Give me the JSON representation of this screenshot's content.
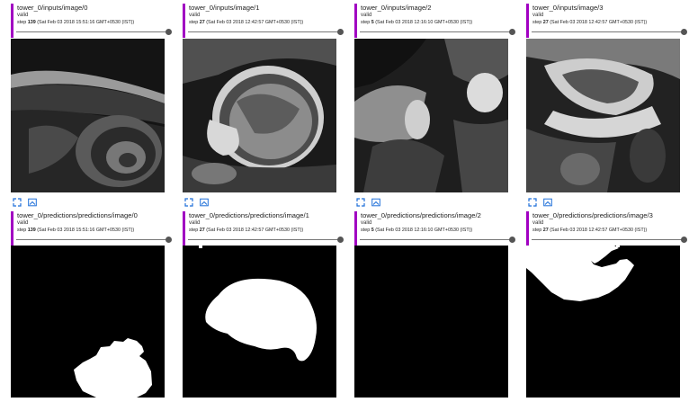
{
  "cards": [
    {
      "tag": "tower_0/inputs/image/0",
      "run": "valid",
      "step_label": "step",
      "step": "139",
      "time": "(Sat Feb 03 2018 15:51:16 GMT+0530 (IST))",
      "kind": "mri"
    },
    {
      "tag": "tower_0/inputs/image/1",
      "run": "valid",
      "step_label": "step",
      "step": "27",
      "time": "(Sat Feb 03 2018 12:42:57 GMT+0530 (IST))",
      "kind": "mri"
    },
    {
      "tag": "tower_0/inputs/image/2",
      "run": "valid",
      "step_label": "step",
      "step": "5",
      "time": "(Sat Feb 03 2018 12:16:10 GMT+0530 (IST))",
      "kind": "mri"
    },
    {
      "tag": "tower_0/inputs/image/3",
      "run": "valid",
      "step_label": "step",
      "step": "27",
      "time": "(Sat Feb 03 2018 12:42:57 GMT+0530 (IST))",
      "kind": "mri"
    },
    {
      "tag": "tower_0/predictions/predictions/image/0",
      "run": "valid",
      "step_label": "step",
      "step": "139",
      "time": "(Sat Feb 03 2018 15:51:16 GMT+0530 (IST))",
      "kind": "mask"
    },
    {
      "tag": "tower_0/predictions/predictions/image/1",
      "run": "valid",
      "step_label": "step",
      "step": "27",
      "time": "(Sat Feb 03 2018 12:42:57 GMT+0530 (IST))",
      "kind": "mask"
    },
    {
      "tag": "tower_0/predictions/predictions/image/2",
      "run": "valid",
      "step_label": "step",
      "step": "5",
      "time": "(Sat Feb 03 2018 12:16:10 GMT+0530 (IST))",
      "kind": "mask"
    },
    {
      "tag": "tower_0/predictions/predictions/image/3",
      "run": "valid",
      "step_label": "step",
      "step": "27",
      "time": "(Sat Feb 03 2018 12:42:57 GMT+0530 (IST))",
      "kind": "mask"
    }
  ],
  "icons": {
    "expand": "fullscreen-icon",
    "actual_size": "actual-size-icon"
  },
  "colors": {
    "accent": "#a100c2",
    "icon": "#1e6fd9",
    "slider": "#555555"
  }
}
